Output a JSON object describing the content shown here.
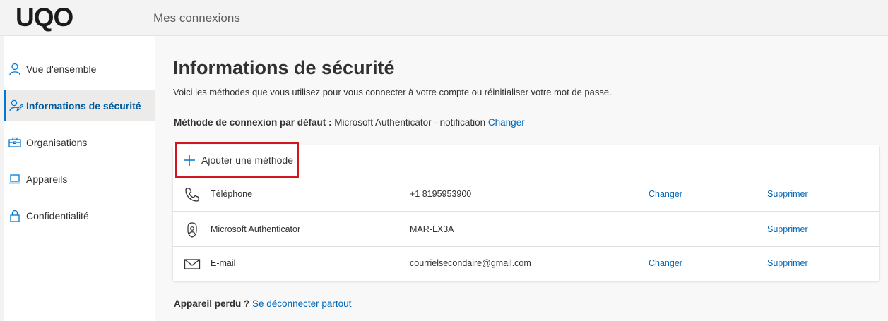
{
  "header": {
    "logo": "UQO",
    "app_title": "Mes connexions"
  },
  "sidebar": {
    "items": [
      {
        "label": "Vue d'ensemble",
        "icon": "person-icon",
        "active": false
      },
      {
        "label": "Informations de sécurité",
        "icon": "security-info-icon",
        "active": true
      },
      {
        "label": "Organisations",
        "icon": "briefcase-icon",
        "active": false
      },
      {
        "label": "Appareils",
        "icon": "laptop-icon",
        "active": false
      },
      {
        "label": "Confidentialité",
        "icon": "lock-icon",
        "active": false
      }
    ]
  },
  "main": {
    "title": "Informations de sécurité",
    "description": "Voici les méthodes que vous utilisez pour vous connecter à votre compte ou réinitialiser votre mot de passe.",
    "default_method": {
      "label": "Méthode de connexion par défaut :",
      "value": "Microsoft Authenticator - notification",
      "change_link": "Changer"
    },
    "add_method_label": "Ajouter une méthode",
    "methods": [
      {
        "icon": "phone-icon",
        "name": "Téléphone",
        "value": "+1 8195953900",
        "change": "Changer",
        "delete": "Supprimer"
      },
      {
        "icon": "authenticator-icon",
        "name": "Microsoft Authenticator",
        "value": "MAR-LX3A",
        "change": "",
        "delete": "Supprimer"
      },
      {
        "icon": "email-icon",
        "name": "E-mail",
        "value": "courrielsecondaire@gmail.com",
        "change": "Changer",
        "delete": "Supprimer"
      }
    ],
    "lost_device": {
      "label": "Appareil perdu ?",
      "link": "Se déconnecter partout"
    }
  },
  "colors": {
    "accent": "#0078d4",
    "link": "#0067b8",
    "highlight_box": "#d0161e"
  }
}
